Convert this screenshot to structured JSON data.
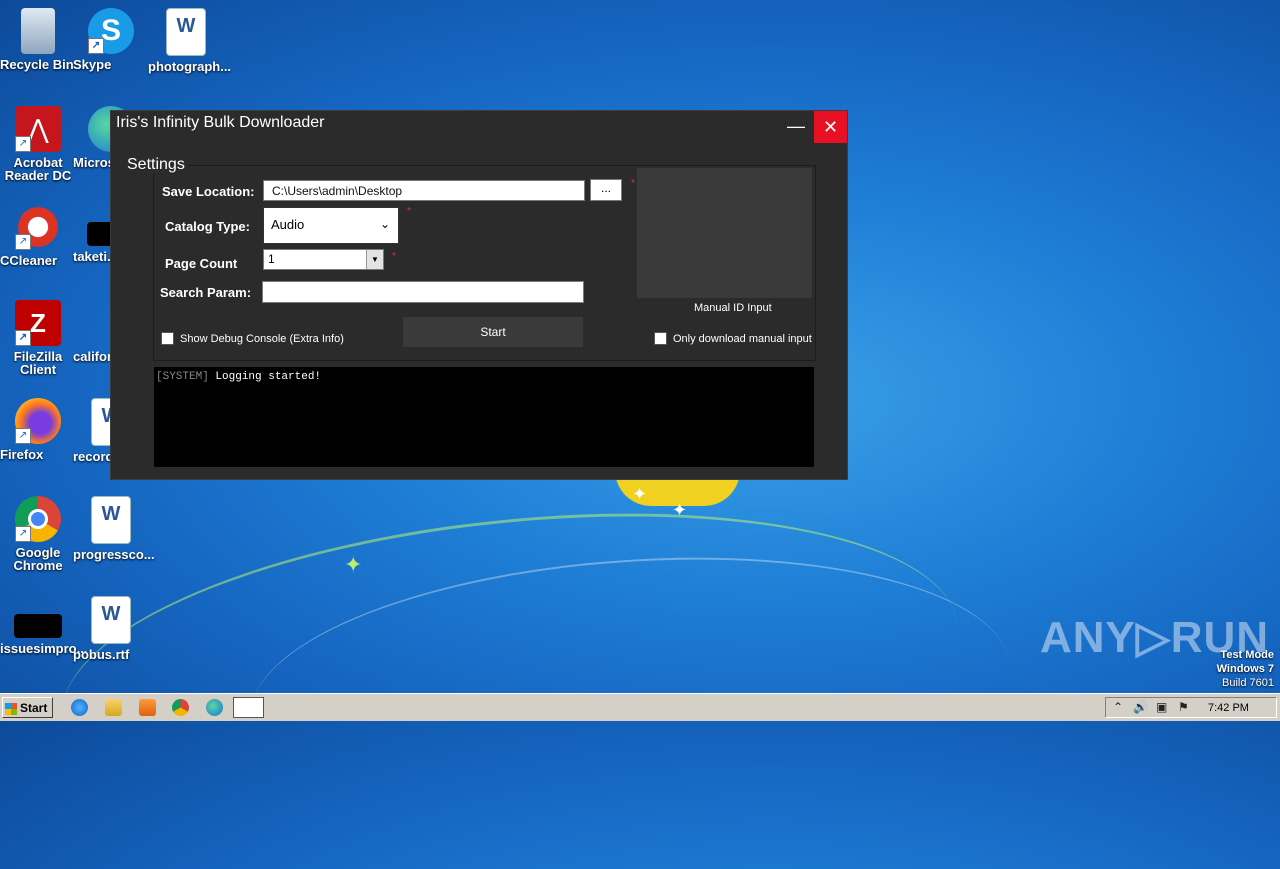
{
  "desktop": {
    "icons": [
      {
        "label": "Recycle Bin"
      },
      {
        "label": "Skype"
      },
      {
        "label": "photograph..."
      },
      {
        "label": "Acrobat Reader DC"
      },
      {
        "label": "Microso..."
      },
      {
        "label": "CCleaner"
      },
      {
        "label": "taketi..."
      },
      {
        "label": "FileZilla Client"
      },
      {
        "label": "califor..."
      },
      {
        "label": "Firefox"
      },
      {
        "label": "recordc..."
      },
      {
        "label": "Google Chrome"
      },
      {
        "label": "progressco..."
      },
      {
        "label": "issuesimpro..."
      },
      {
        "label": "pobus.rtf"
      }
    ]
  },
  "window": {
    "title": "Iris's Infinity Bulk Downloader",
    "minimize": "—",
    "close": "✕",
    "settings_title": "Settings",
    "save_location_label": "Save Location:",
    "save_location_value": "C:\\Users\\admin\\Desktop",
    "browse_label": "...",
    "catalog_type_label": "Catalog Type:",
    "catalog_type_value": "Audio",
    "page_count_label": "Page Count",
    "page_count_value": "1",
    "search_param_label": "Search Param:",
    "search_param_value": "",
    "show_debug_label": "Show Debug Console (Extra Info)",
    "start_label": "Start",
    "manual_id_label": "Manual ID Input",
    "only_manual_label": "Only download manual input",
    "required_mark": "*",
    "console": {
      "tag": "[SYSTEM]",
      "message": " Logging started!"
    }
  },
  "watermark": {
    "brand": "ANY▷RUN",
    "test_mode": "Test Mode",
    "os": "Windows 7",
    "build": "Build 7601"
  },
  "taskbar": {
    "start_label": "Start",
    "clock": "7:42 PM"
  }
}
